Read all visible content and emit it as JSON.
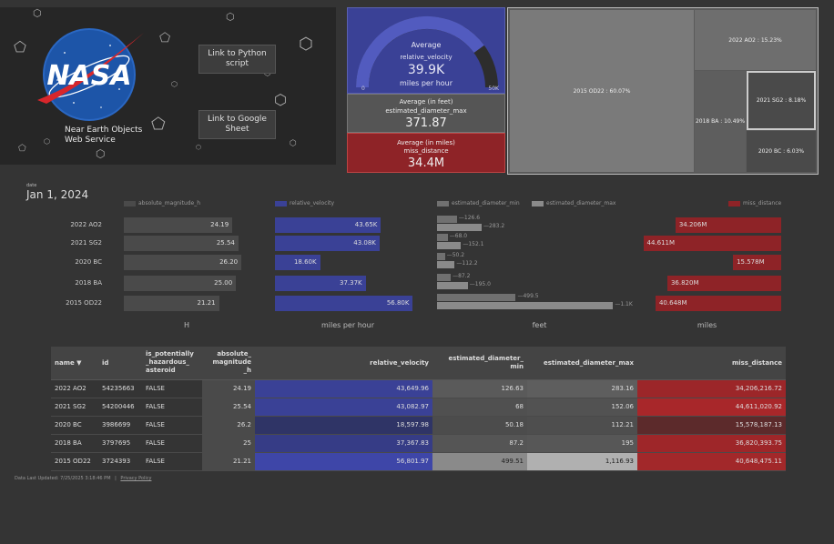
{
  "hero": {
    "logo_text": "NASA",
    "subtitle": "Near Earth Objects Web Service",
    "button_python": "Link to Python script",
    "button_sheet": "Link to Google Sheet"
  },
  "gauge": {
    "label1": "Average",
    "label2": "relative_velocity",
    "value": "39.9K",
    "unit": "miles per hour",
    "min": "0",
    "max": "50K",
    "fraction": 0.798
  },
  "card_diameter": {
    "label1": "Average (in feet)",
    "label2": "estimated_diameter_max",
    "value": "371.87"
  },
  "card_miss": {
    "label1": "Average (in miles)",
    "label2": "miss_distance",
    "value": "34.4M"
  },
  "treemap": [
    {
      "label": "2015 OD22 : 60.07%",
      "color": "#7a7a7a"
    },
    {
      "label": "2022 AO2 : 15.23%",
      "color": "#6e6e6e"
    },
    {
      "label": "2018 BA : 10.49%",
      "color": "#5e5e5e"
    },
    {
      "label": "2021 SG2 : 8.18%",
      "color": "#4a4a4a"
    },
    {
      "label": "2020 BC : 6.03%",
      "color": "#4a4a4a"
    }
  ],
  "date": {
    "caption": "date",
    "value": "Jan 1, 2024"
  },
  "chart_data": [
    {
      "type": "bar",
      "categories": [
        "2022 AO2",
        "2021 SG2",
        "2020 BC",
        "2018 BA",
        "2015 OD22"
      ],
      "series": [
        {
          "name": "absolute_magnitude_h",
          "values": [
            24.19,
            25.54,
            26.2,
            25.0,
            21.21
          ],
          "labels": [
            "24.19",
            "25.54",
            "26.20",
            "25.00",
            "21.21"
          ],
          "color": "#4a4a4a"
        }
      ],
      "xlabel": "H",
      "xlim": [
        0,
        28
      ]
    },
    {
      "type": "bar",
      "categories": [
        "2022 AO2",
        "2021 SG2",
        "2020 BC",
        "2018 BA",
        "2015 OD22"
      ],
      "series": [
        {
          "name": "relative_velocity",
          "values": [
            43650,
            43083,
            18598,
            37368,
            56802
          ],
          "labels": [
            "43.65K",
            "43.08K",
            "18.60K",
            "37.37K",
            "56.80K"
          ],
          "color": "#3a4196"
        }
      ],
      "xlabel": "miles per hour",
      "xlim": [
        0,
        60000
      ]
    },
    {
      "type": "bar",
      "categories": [
        "2022 AO2",
        "2021 SG2",
        "2020 BC",
        "2018 BA",
        "2015 OD22"
      ],
      "series": [
        {
          "name": "estimated_diameter_min",
          "values": [
            126.6,
            68.0,
            50.2,
            87.2,
            499.5
          ],
          "labels": [
            "126.6",
            "68.0",
            "50.2",
            "87.2",
            "499.5"
          ],
          "color": "#707070"
        },
        {
          "name": "estimated_diameter_max",
          "values": [
            283.2,
            152.1,
            112.2,
            195.0,
            1116.93
          ],
          "labels": [
            "283.2",
            "152.1",
            "112.2",
            "195.0",
            "1.1K"
          ],
          "color": "#8a8a8a"
        }
      ],
      "xlabel": "feet",
      "xlim": [
        0,
        1300
      ]
    },
    {
      "type": "bar",
      "categories": [
        "2022 AO2",
        "2021 SG2",
        "2020 BC",
        "2018 BA",
        "2015 OD22"
      ],
      "series": [
        {
          "name": "miss_distance",
          "values": [
            34206216.72,
            44611020.92,
            15578187.13,
            36820393.75,
            40648475.11
          ],
          "labels": [
            "34.206M",
            "44.611M",
            "15.578M",
            "36.820M",
            "40.648M"
          ],
          "color": "#8e2327"
        }
      ],
      "xlabel": "miles",
      "xlim": [
        0,
        48000000
      ],
      "direction": "right-to-left"
    }
  ],
  "table": {
    "headers": [
      "name ▼",
      "id",
      "is_potentially _hazardous_ asteroid",
      "absolute_ magnitude _h",
      "relative_velocity",
      "estimated_diameter_ min",
      "estimated_diameter_max",
      "miss_distance"
    ],
    "rows": [
      [
        "2022 AO2",
        "54235663",
        "FALSE",
        "24.19",
        "43,649.96",
        "126.63",
        "283.16",
        "34,206,216.72"
      ],
      [
        "2021 SG2",
        "54200446",
        "FALSE",
        "25.54",
        "43,082.97",
        "68",
        "152.06",
        "44,611,020.92"
      ],
      [
        "2020 BC",
        "3986699",
        "FALSE",
        "26.2",
        "18,597.98",
        "50.18",
        "112.21",
        "15,578,187.13"
      ],
      [
        "2018 BA",
        "3797695",
        "FALSE",
        "25",
        "37,367.83",
        "87.2",
        "195",
        "36,820,393.75"
      ],
      [
        "2015 OD22",
        "3724393",
        "FALSE",
        "21.21",
        "56,801.97",
        "499.51",
        "1,116.93",
        "40,648,475.11"
      ]
    ]
  },
  "footer": {
    "updated": "Data Last Updated: 7/25/2025 3:18:46 PM",
    "sep": "|",
    "privacy": "Privacy Policy"
  }
}
